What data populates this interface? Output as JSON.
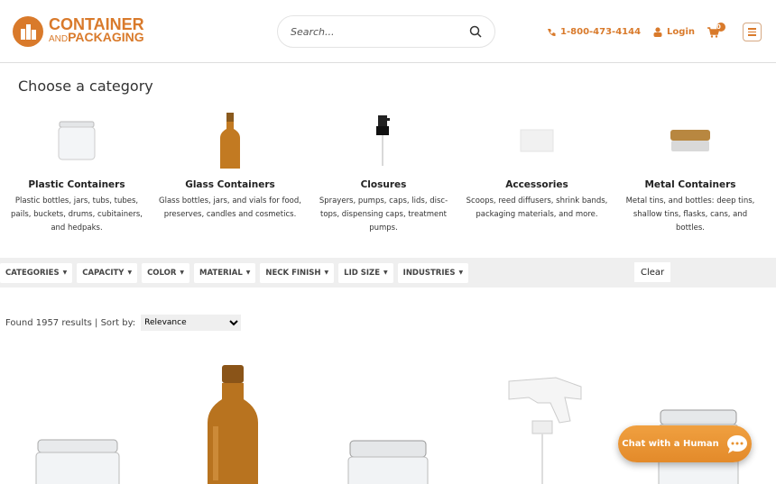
{
  "header": {
    "logo_line1": "CONTAINER",
    "logo_and": "AND",
    "logo_line2": "PACKAGING",
    "search_placeholder": "Search...",
    "phone": "1-800-473-4144",
    "login": "Login",
    "cart_count": "0"
  },
  "page_title": "Choose a category",
  "categories": [
    {
      "name": "Plastic Containers",
      "desc": "Plastic bottles, jars, tubs, tubes, pails, buckets, drums, cubitainers, and hedpaks."
    },
    {
      "name": "Glass Containers",
      "desc": "Glass bottles, jars, and vials for food, preserves, candles and cosmetics."
    },
    {
      "name": "Closures",
      "desc": "Sprayers, pumps, caps, lids, disc-tops, dispensing caps, treatment pumps."
    },
    {
      "name": "Accessories",
      "desc": "Scoops, reed diffusers, shrink bands, packaging materials, and more."
    },
    {
      "name": "Metal Containers",
      "desc": "Metal tins, and bottles: deep tins, shallow tins, flasks, cans, and bottles."
    }
  ],
  "filters": [
    "CATEGORIES",
    "CAPACITY",
    "COLOR",
    "MATERIAL",
    "NECK FINISH",
    "LID SIZE",
    "INDUSTRIES"
  ],
  "clear_label": "Clear",
  "results": {
    "text": "Found 1957 results | Sort by:",
    "sort_selected": "Relevance"
  },
  "chat_label": "Chat with a Human",
  "colors": {
    "brand": "#d97a2b",
    "chat": "#e8922f",
    "filter_bar": "#efefef"
  }
}
